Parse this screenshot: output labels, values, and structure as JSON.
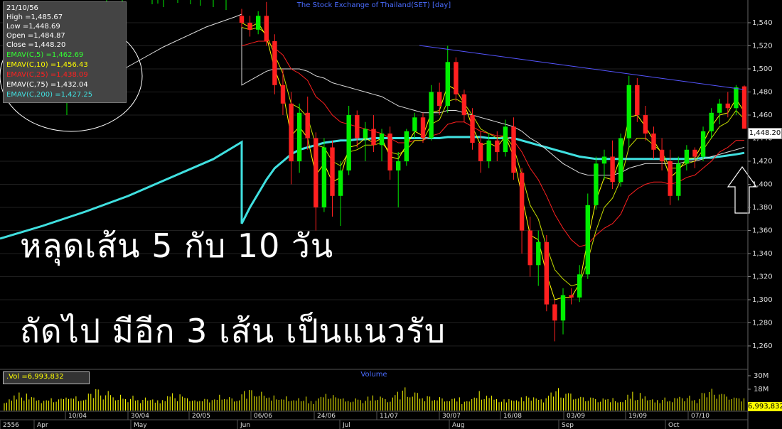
{
  "chart_title": "The Stock Exchange of Thailand(SET) [day]",
  "volume_title": "Volume",
  "info": {
    "date": "21/10/56",
    "high": "High  =1,485.67",
    "low": "Low  =1,448.69",
    "open": "Open  =1,484.87",
    "close": "Close  =1,448.20",
    "emav5": "EMAV(C,5)    =1,462.69",
    "emav10": "EMAV(C,10)    =1,456.43",
    "emav25": "EMAV(C,25)    =1,438.09",
    "emav75": "EMAV(C,75)    =1,432.04",
    "emav200": "EMAV(C,200)   =1,427.25"
  },
  "overlay": {
    "line1": "หลุดเส้น 5 กับ 10 วัน",
    "line2": "ถัดไป มีอีก 3 เส้น เป็นแนวรับ"
  },
  "volume_box": ".Vol   =6,993,832",
  "close_tag": "1,448.20",
  "vol_tag": "6,993,832",
  "colors": {
    "bull": "#00ee00",
    "bear": "#ff2020",
    "ema5": "#ffff00",
    "ema10": "#c8e000",
    "ema25": "#ff2020",
    "ema75": "#dddddd",
    "ema200": "#40e0e0",
    "trend": "#5555ff",
    "grid": "#202020",
    "volume": "#ffff00"
  },
  "chart_data": {
    "type": "candlestick",
    "title": "The Stock Exchange of Thailand(SET) [day]",
    "y_ticks": [
      "1,540",
      "1,520",
      "1,500",
      "1,480",
      "1,460",
      "1,440",
      "1,420",
      "1,400",
      "1,380",
      "1,360",
      "1,340",
      "1,320",
      "1,300",
      "1,280",
      "1,260"
    ],
    "y_tick_values": [
      1540,
      1520,
      1500,
      1480,
      1460,
      1440,
      1420,
      1400,
      1380,
      1360,
      1340,
      1320,
      1300,
      1280,
      1260
    ],
    "ylim": [
      1245,
      1560
    ],
    "volume_ticks": [
      "30M",
      "18M"
    ],
    "x_date_labels": [
      "10/04",
      "30/04",
      "20/05",
      "06/06",
      "24/06",
      "11/07",
      "30/07",
      "16/08",
      "03/09",
      "19/09",
      "07/10"
    ],
    "x_month_labels": [
      "2556",
      "Apr",
      "May",
      "Jun",
      "Jul",
      "Aug",
      "Sep",
      "Oct"
    ],
    "candles": [
      {
        "o": 1546,
        "h": 1552,
        "l": 1536,
        "c": 1540
      },
      {
        "o": 1540,
        "h": 1546,
        "l": 1528,
        "c": 1534
      },
      {
        "o": 1534,
        "h": 1550,
        "l": 1530,
        "c": 1546
      },
      {
        "o": 1546,
        "h": 1558,
        "l": 1520,
        "c": 1524
      },
      {
        "o": 1524,
        "h": 1530,
        "l": 1478,
        "c": 1486
      },
      {
        "o": 1486,
        "h": 1500,
        "l": 1460,
        "c": 1470
      },
      {
        "o": 1470,
        "h": 1480,
        "l": 1400,
        "c": 1420
      },
      {
        "o": 1420,
        "h": 1470,
        "l": 1410,
        "c": 1462
      },
      {
        "o": 1462,
        "h": 1476,
        "l": 1430,
        "c": 1440
      },
      {
        "o": 1440,
        "h": 1445,
        "l": 1360,
        "c": 1380
      },
      {
        "o": 1380,
        "h": 1440,
        "l": 1376,
        "c": 1432
      },
      {
        "o": 1432,
        "h": 1438,
        "l": 1372,
        "c": 1390
      },
      {
        "o": 1390,
        "h": 1420,
        "l": 1364,
        "c": 1412
      },
      {
        "o": 1412,
        "h": 1468,
        "l": 1408,
        "c": 1460
      },
      {
        "o": 1460,
        "h": 1464,
        "l": 1432,
        "c": 1440
      },
      {
        "o": 1440,
        "h": 1454,
        "l": 1420,
        "c": 1448
      },
      {
        "o": 1448,
        "h": 1460,
        "l": 1428,
        "c": 1434
      },
      {
        "o": 1434,
        "h": 1448,
        "l": 1420,
        "c": 1444
      },
      {
        "o": 1444,
        "h": 1450,
        "l": 1404,
        "c": 1412
      },
      {
        "o": 1412,
        "h": 1428,
        "l": 1380,
        "c": 1420
      },
      {
        "o": 1420,
        "h": 1448,
        "l": 1416,
        "c": 1446
      },
      {
        "o": 1446,
        "h": 1462,
        "l": 1440,
        "c": 1458
      },
      {
        "o": 1458,
        "h": 1462,
        "l": 1436,
        "c": 1440
      },
      {
        "o": 1440,
        "h": 1486,
        "l": 1438,
        "c": 1480
      },
      {
        "o": 1480,
        "h": 1488,
        "l": 1460,
        "c": 1468
      },
      {
        "o": 1468,
        "h": 1520,
        "l": 1462,
        "c": 1506
      },
      {
        "o": 1506,
        "h": 1510,
        "l": 1472,
        "c": 1478
      },
      {
        "o": 1478,
        "h": 1482,
        "l": 1454,
        "c": 1460
      },
      {
        "o": 1460,
        "h": 1466,
        "l": 1430,
        "c": 1436
      },
      {
        "o": 1436,
        "h": 1446,
        "l": 1410,
        "c": 1420
      },
      {
        "o": 1420,
        "h": 1444,
        "l": 1414,
        "c": 1438
      },
      {
        "o": 1438,
        "h": 1446,
        "l": 1420,
        "c": 1428
      },
      {
        "o": 1428,
        "h": 1456,
        "l": 1424,
        "c": 1450
      },
      {
        "o": 1450,
        "h": 1458,
        "l": 1404,
        "c": 1410
      },
      {
        "o": 1410,
        "h": 1414,
        "l": 1340,
        "c": 1360
      },
      {
        "o": 1360,
        "h": 1372,
        "l": 1320,
        "c": 1330
      },
      {
        "o": 1330,
        "h": 1360,
        "l": 1312,
        "c": 1350
      },
      {
        "o": 1350,
        "h": 1356,
        "l": 1290,
        "c": 1296
      },
      {
        "o": 1296,
        "h": 1300,
        "l": 1264,
        "c": 1282
      },
      {
        "o": 1282,
        "h": 1310,
        "l": 1270,
        "c": 1304
      },
      {
        "o": 1304,
        "h": 1310,
        "l": 1296,
        "c": 1302
      },
      {
        "o": 1302,
        "h": 1330,
        "l": 1298,
        "c": 1322
      },
      {
        "o": 1322,
        "h": 1392,
        "l": 1318,
        "c": 1382
      },
      {
        "o": 1382,
        "h": 1424,
        "l": 1378,
        "c": 1418
      },
      {
        "o": 1418,
        "h": 1430,
        "l": 1404,
        "c": 1424
      },
      {
        "o": 1424,
        "h": 1438,
        "l": 1396,
        "c": 1402
      },
      {
        "o": 1402,
        "h": 1444,
        "l": 1398,
        "c": 1440
      },
      {
        "o": 1440,
        "h": 1494,
        "l": 1432,
        "c": 1486
      },
      {
        "o": 1486,
        "h": 1492,
        "l": 1454,
        "c": 1460
      },
      {
        "o": 1460,
        "h": 1468,
        "l": 1438,
        "c": 1444
      },
      {
        "o": 1444,
        "h": 1450,
        "l": 1422,
        "c": 1430
      },
      {
        "o": 1430,
        "h": 1440,
        "l": 1412,
        "c": 1420
      },
      {
        "o": 1420,
        "h": 1430,
        "l": 1382,
        "c": 1390
      },
      {
        "o": 1390,
        "h": 1424,
        "l": 1386,
        "c": 1418
      },
      {
        "o": 1418,
        "h": 1434,
        "l": 1412,
        "c": 1430
      },
      {
        "o": 1430,
        "h": 1432,
        "l": 1414,
        "c": 1424
      },
      {
        "o": 1424,
        "h": 1450,
        "l": 1420,
        "c": 1446
      },
      {
        "o": 1446,
        "h": 1466,
        "l": 1440,
        "c": 1462
      },
      {
        "o": 1462,
        "h": 1474,
        "l": 1452,
        "c": 1470
      },
      {
        "o": 1470,
        "h": 1480,
        "l": 1458,
        "c": 1466
      },
      {
        "o": 1466,
        "h": 1486,
        "l": 1460,
        "c": 1484
      },
      {
        "o": 1484.87,
        "h": 1485.67,
        "l": 1448.69,
        "c": 1448.2
      }
    ],
    "ema5": [
      1540,
      1536,
      1540,
      1528,
      1500,
      1480,
      1442,
      1450,
      1440,
      1408,
      1418,
      1402,
      1406,
      1432,
      1434,
      1440,
      1436,
      1440,
      1424,
      1422,
      1434,
      1446,
      1442,
      1462,
      1464,
      1486,
      1482,
      1470,
      1450,
      1434,
      1436,
      1432,
      1442,
      1424,
      1390,
      1356,
      1352,
      1322,
      1300,
      1302,
      1302,
      1314,
      1352,
      1386,
      1406,
      1404,
      1424,
      1458,
      1460,
      1450,
      1438,
      1426,
      1406,
      1412,
      1422,
      1423,
      1436,
      1450,
      1460,
      1462,
      1474,
      1462.69
    ],
    "ema10": [
      1536,
      1534,
      1536,
      1530,
      1512,
      1496,
      1470,
      1466,
      1458,
      1434,
      1432,
      1420,
      1416,
      1428,
      1430,
      1434,
      1434,
      1436,
      1428,
      1426,
      1430,
      1438,
      1438,
      1452,
      1456,
      1472,
      1474,
      1470,
      1460,
      1448,
      1444,
      1440,
      1442,
      1432,
      1408,
      1382,
      1370,
      1346,
      1326,
      1318,
      1312,
      1314,
      1334,
      1360,
      1380,
      1388,
      1404,
      1432,
      1440,
      1440,
      1434,
      1428,
      1414,
      1414,
      1418,
      1420,
      1430,
      1440,
      1450,
      1454,
      1464,
      1456.43
    ],
    "ema25": [
      1520,
      1522,
      1524,
      1524,
      1518,
      1512,
      1500,
      1496,
      1490,
      1476,
      1470,
      1460,
      1454,
      1452,
      1450,
      1448,
      1446,
      1444,
      1440,
      1436,
      1436,
      1438,
      1438,
      1442,
      1444,
      1452,
      1454,
      1454,
      1450,
      1446,
      1444,
      1442,
      1442,
      1438,
      1428,
      1414,
      1404,
      1390,
      1374,
      1362,
      1352,
      1346,
      1348,
      1356,
      1362,
      1366,
      1374,
      1390,
      1396,
      1400,
      1402,
      1402,
      1400,
      1402,
      1406,
      1408,
      1414,
      1420,
      1428,
      1432,
      1438,
      1438.09
    ],
    "ema75": [
      1486,
      1490,
      1494,
      1498,
      1500,
      1500,
      1500,
      1500,
      1498,
      1494,
      1492,
      1488,
      1486,
      1484,
      1482,
      1480,
      1478,
      1476,
      1472,
      1468,
      1466,
      1464,
      1462,
      1462,
      1462,
      1464,
      1464,
      1462,
      1460,
      1458,
      1456,
      1454,
      1452,
      1450,
      1446,
      1440,
      1436,
      1430,
      1424,
      1418,
      1414,
      1410,
      1408,
      1408,
      1408,
      1408,
      1410,
      1414,
      1416,
      1418,
      1418,
      1418,
      1418,
      1418,
      1420,
      1420,
      1422,
      1424,
      1426,
      1428,
      1430,
      1432.04
    ],
    "ema200": [
      1366,
      1380,
      1392,
      1404,
      1414,
      1420,
      1426,
      1430,
      1432,
      1434,
      1436,
      1437,
      1438,
      1438,
      1439,
      1439,
      1440,
      1440,
      1440,
      1440,
      1440,
      1440,
      1440,
      1440,
      1440,
      1441,
      1441,
      1441,
      1441,
      1441,
      1440,
      1440,
      1440,
      1440,
      1438,
      1436,
      1434,
      1432,
      1430,
      1428,
      1426,
      1424,
      1423,
      1422,
      1422,
      1422,
      1422,
      1422,
      1422,
      1422,
      1422,
      1422,
      1422,
      1422,
      1422,
      1422,
      1423,
      1423,
      1424,
      1425,
      1426,
      1427.25
    ],
    "volume_values": [
      8,
      7,
      9,
      10,
      14,
      12,
      18,
      11,
      10,
      16,
      12,
      13,
      11,
      10,
      9,
      8,
      9,
      8,
      10,
      11,
      9,
      8,
      9,
      12,
      10,
      14,
      11,
      10,
      12,
      13,
      10,
      9,
      8,
      11,
      16,
      18,
      12,
      20,
      22,
      14,
      12,
      15,
      18,
      16,
      12,
      11,
      10,
      14,
      12,
      10,
      9,
      11,
      13,
      10,
      9,
      8,
      10,
      11,
      10,
      9,
      12,
      7
    ]
  }
}
